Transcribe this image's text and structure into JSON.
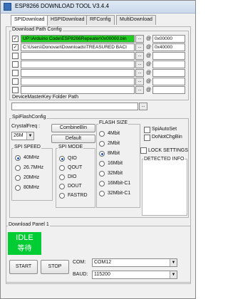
{
  "window": {
    "title": "ESP8266 DOWNLOAD TOOL V3.4.4"
  },
  "tabs": [
    "SPIDownload",
    "HSPIDownload",
    "RFConfig",
    "MultiDownload"
  ],
  "download_path": {
    "label": "Download Path Config",
    "rows": [
      {
        "checked": true,
        "path": "UP:\\Arduino Code\\ESP8266Repeater\\0x00000.bin",
        "highlight": true,
        "address": "0x00000"
      },
      {
        "checked": true,
        "path": "C:\\Users\\Donovan\\Downloads\\TREASURED BACI",
        "highlight": false,
        "address": "0x40000"
      },
      {
        "checked": false,
        "path": "",
        "highlight": false,
        "address": ""
      },
      {
        "checked": false,
        "path": "",
        "highlight": false,
        "address": ""
      },
      {
        "checked": false,
        "path": "",
        "highlight": false,
        "address": ""
      },
      {
        "checked": false,
        "path": "",
        "highlight": false,
        "address": ""
      },
      {
        "checked": false,
        "path": "",
        "highlight": false,
        "address": ""
      }
    ],
    "dots_label": "...",
    "at_symbol": "@"
  },
  "master_key": {
    "label": "DeviceMasterKey Folder Path",
    "value": ""
  },
  "spiflash": {
    "label": "SpiFlashConfig",
    "crystal_label": "CrystalFreq :",
    "crystal_value": "26M",
    "combine_label": "CombineBin",
    "default_label": "Default",
    "speed_label": "SPI SPEED",
    "speeds": [
      "40MHz",
      "26.7MHz",
      "20MHz",
      "80MHz"
    ],
    "speed_selected": 0,
    "mode_label": "SPI MODE",
    "modes": [
      "QIO",
      "QOUT",
      "DIO",
      "DOUT",
      "FASTRD"
    ],
    "mode_selected": 0,
    "size_label": "FLASH SIZE",
    "sizes": [
      "4Mbit",
      "2Mbit",
      "8Mbit",
      "16Mbit",
      "32Mbit",
      "16Mbit-C1",
      "32Mbit-C1"
    ],
    "size_selected": 2,
    "autoset_label": "SpiAutoSet",
    "dontchg_label": "DoNotChgBin",
    "lock_label": "LOCK SETTINGS",
    "detected_label": "DETECTED INFO"
  },
  "download_panel": {
    "label": "Download Panel 1",
    "status": "IDLE",
    "status_sub": "等待",
    "start_label": "START",
    "stop_label": "STOP",
    "com_label": "COM:",
    "com_value": "COM12",
    "baud_label": "BAUD:",
    "baud_value": "115200"
  },
  "colors": {
    "highlight": "#22cc22",
    "idle": "#00cc33"
  }
}
